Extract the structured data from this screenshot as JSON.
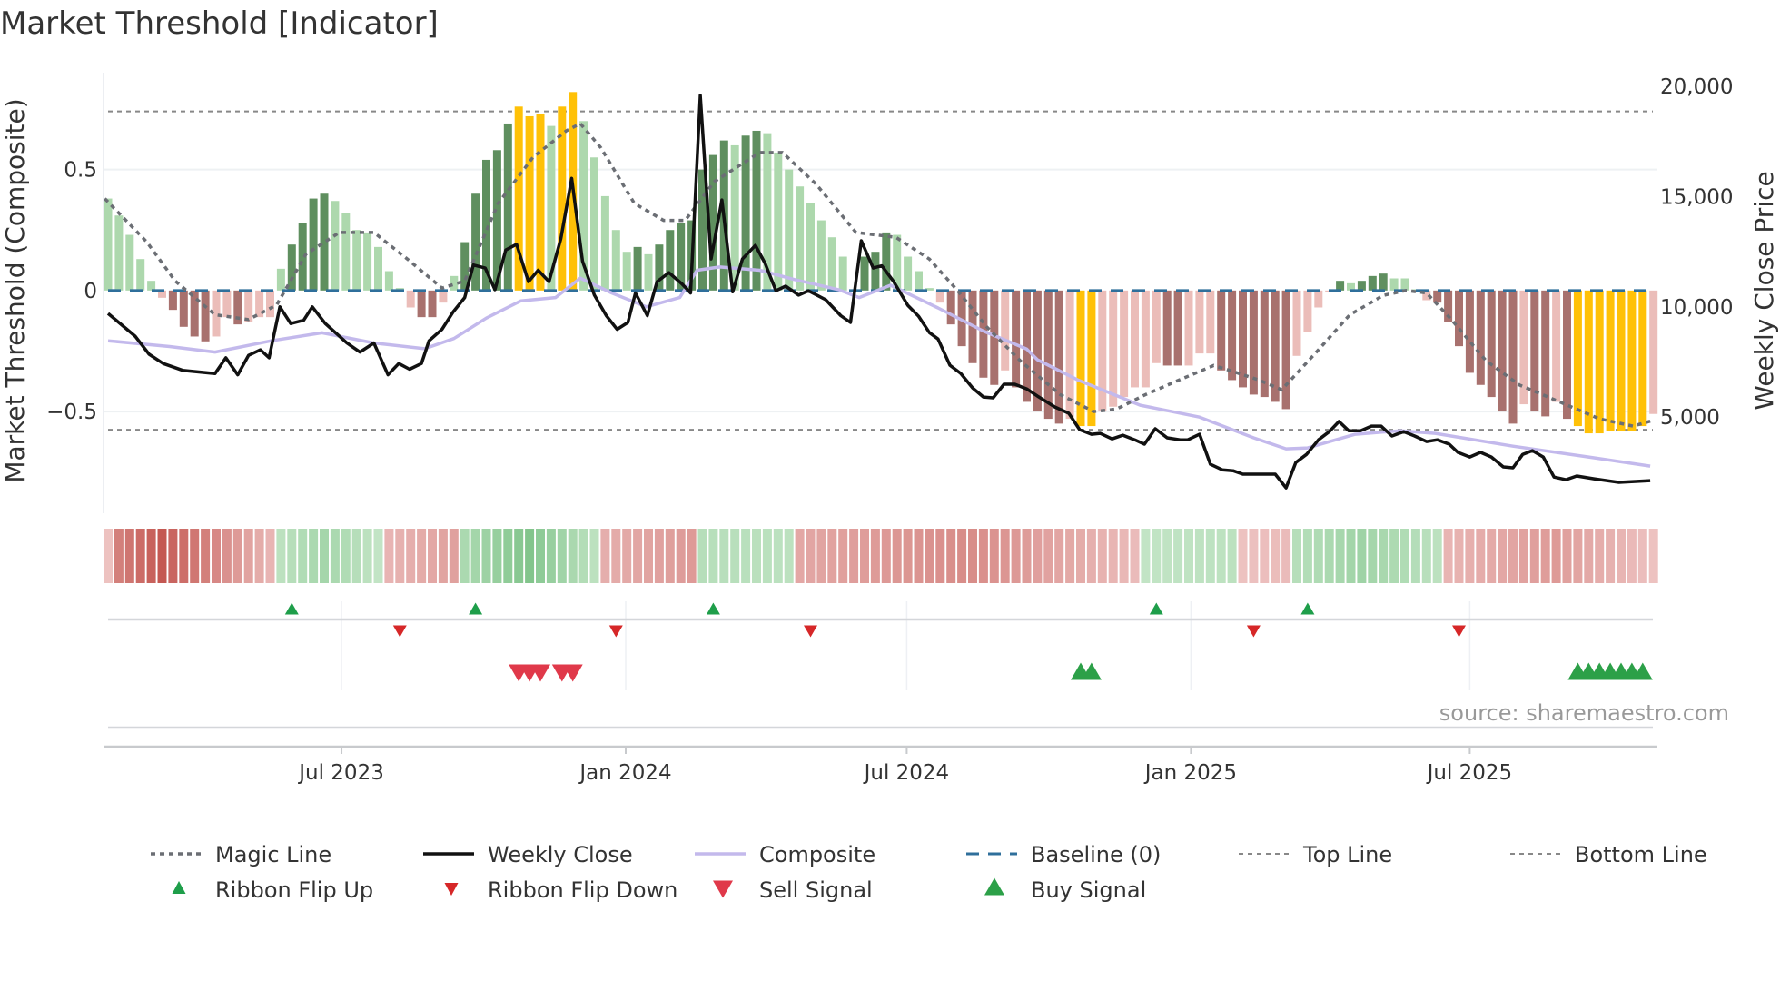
{
  "title": "Market Threshold [Indicator]",
  "source": "source: sharemaestro.com",
  "colors": {
    "dark_green": "#5f8f5f",
    "light_green": "#add8ad",
    "dark_red": "#a8716e",
    "light_pink": "#ebbdb9",
    "yellow": "#ffc107",
    "close": "#111111",
    "composite": "#c3b9ec",
    "magic": "#6b6e74",
    "baseline": "#2f6f9b",
    "threshold": "#888888",
    "flip_up": "#1e9e4a",
    "flip_down": "#d62728",
    "sell": "#e0394a",
    "buy": "#2ca048"
  },
  "chart_data": {
    "type": "bar+line",
    "title": "Market Threshold [Indicator]",
    "ylabel_left": "Market Threshold (Composite)",
    "ylabel_right": "Weekly Close Price",
    "ylim_left": [
      -0.92,
      0.9
    ],
    "ylim_right": [
      640,
      20620
    ],
    "xlim": [
      0.6,
      144.4
    ],
    "left_ticks": [
      {
        "v": 0.5,
        "label": "0.5"
      },
      {
        "v": 0,
        "label": "0"
      },
      {
        "v": -0.5,
        "label": "−0.5"
      }
    ],
    "right_ticks": [
      {
        "v": 20000,
        "label": "20,000"
      },
      {
        "v": 15000,
        "label": "15,000"
      },
      {
        "v": 10000,
        "label": "10,000"
      },
      {
        "v": 5000,
        "label": "5,000"
      }
    ],
    "x_ticks": [
      {
        "week": 22.6,
        "label": "Jul 2023"
      },
      {
        "week": 48.9,
        "label": "Jan 2024"
      },
      {
        "week": 74.9,
        "label": "Jul 2024"
      },
      {
        "week": 101.2,
        "label": "Jan 2025"
      },
      {
        "week": 127,
        "label": "Jul 2025"
      }
    ],
    "top_line": 0.74,
    "bottom_line": -0.575,
    "baseline": 0,
    "bar_values": [
      0.38,
      0.31,
      0.23,
      0.13,
      0.04,
      -0.03,
      -0.08,
      -0.15,
      -0.19,
      -0.21,
      -0.19,
      -0.11,
      -0.14,
      -0.13,
      -0.11,
      -0.11,
      0.09,
      0.19,
      0.28,
      0.38,
      0.4,
      0.37,
      0.32,
      0.25,
      0.24,
      0.18,
      0.08,
      0.01,
      -0.07,
      -0.11,
      -0.11,
      -0.05,
      0.06,
      0.2,
      0.4,
      0.54,
      0.58,
      0.69,
      0.76,
      0.72,
      0.73,
      0.68,
      0.76,
      0.82,
      0.7,
      0.55,
      0.39,
      0.25,
      0.16,
      0.18,
      0.15,
      0.19,
      0.25,
      0.28,
      0.29,
      0.5,
      0.56,
      0.62,
      0.6,
      0.64,
      0.66,
      0.65,
      0.57,
      0.5,
      0.43,
      0.36,
      0.29,
      0.22,
      0.14,
      0.005,
      0.14,
      0.16,
      0.24,
      0.23,
      0.14,
      0.08,
      0.01,
      -0.05,
      -0.14,
      -0.23,
      -0.3,
      -0.36,
      -0.39,
      -0.33,
      -0.4,
      -0.46,
      -0.5,
      -0.53,
      -0.55,
      -0.53,
      -0.56,
      -0.56,
      -0.5,
      -0.48,
      -0.44,
      -0.4,
      -0.4,
      -0.3,
      -0.31,
      -0.31,
      -0.31,
      -0.26,
      -0.26,
      -0.33,
      -0.37,
      -0.4,
      -0.43,
      -0.44,
      -0.46,
      -0.49,
      -0.27,
      -0.17,
      -0.07,
      -0.005,
      0.04,
      0.03,
      0.04,
      0.06,
      0.07,
      0.05,
      0.05,
      0.005,
      -0.04,
      -0.05,
      -0.13,
      -0.23,
      -0.34,
      -0.39,
      -0.44,
      -0.5,
      -0.55,
      -0.47,
      -0.5,
      -0.52,
      -0.46,
      -0.53,
      -0.56,
      -0.59,
      -0.59,
      -0.58,
      -0.58,
      -0.58,
      -0.56,
      -0.51
    ],
    "bar_kinds": [
      "lg",
      "lg",
      "lg",
      "lg",
      "lg",
      "lp",
      "dr",
      "dr",
      "dr",
      "dr",
      "lp",
      "lp",
      "dr",
      "lp",
      "lp",
      "lp",
      "lg",
      "dg",
      "dg",
      "dg",
      "dg",
      "lg",
      "lg",
      "lg",
      "lg",
      "lg",
      "lg",
      "lg",
      "lp",
      "dr",
      "dr",
      "lp",
      "lg",
      "dg",
      "dg",
      "dg",
      "dg",
      "dg",
      "y",
      "y",
      "y",
      "lg",
      "y",
      "y",
      "lg",
      "lg",
      "lg",
      "lg",
      "lg",
      "dg",
      "lg",
      "dg",
      "dg",
      "dg",
      "dg",
      "dg",
      "dg",
      "dg",
      "lg",
      "dg",
      "dg",
      "lg",
      "lg",
      "lg",
      "lg",
      "lg",
      "lg",
      "lg",
      "lg",
      "lg",
      "dg",
      "dg",
      "dg",
      "lg",
      "lg",
      "lg",
      "lg",
      "lp",
      "dr",
      "dr",
      "dr",
      "dr",
      "dr",
      "lp",
      "dr",
      "dr",
      "dr",
      "dr",
      "dr",
      "lp",
      "y",
      "y",
      "lp",
      "lp",
      "lp",
      "lp",
      "lp",
      "lp",
      "dr",
      "dr",
      "lp",
      "lp",
      "lp",
      "dr",
      "dr",
      "dr",
      "dr",
      "dr",
      "dr",
      "dr",
      "lp",
      "lp",
      "lp",
      "lp",
      "dg",
      "lg",
      "dg",
      "dg",
      "dg",
      "lg",
      "lg",
      "lg",
      "lp",
      "dr",
      "dr",
      "dr",
      "dr",
      "dr",
      "dr",
      "dr",
      "dr",
      "lp",
      "dr",
      "dr",
      "lp",
      "dr",
      "y",
      "y",
      "y",
      "y",
      "y",
      "y",
      "y",
      "lp"
    ],
    "weekly_close": [
      [
        1,
        9700
      ],
      [
        3.5,
        8670
      ],
      [
        4.8,
        7850
      ],
      [
        6.1,
        7430
      ],
      [
        7.9,
        7120
      ],
      [
        10.9,
        6970
      ],
      [
        11.9,
        7690
      ],
      [
        13,
        6920
      ],
      [
        14,
        7800
      ],
      [
        15.1,
        8050
      ],
      [
        15.9,
        7690
      ],
      [
        16.9,
        10000
      ],
      [
        17.9,
        9240
      ],
      [
        19.1,
        9390
      ],
      [
        19.9,
        10000
      ],
      [
        21.1,
        9240
      ],
      [
        23.1,
        8360
      ],
      [
        24.3,
        7950
      ],
      [
        25.6,
        8360
      ],
      [
        26.9,
        6920
      ],
      [
        27.9,
        7430
      ],
      [
        28.9,
        7170
      ],
      [
        30,
        7430
      ],
      [
        30.7,
        8460
      ],
      [
        31.9,
        8980
      ],
      [
        32.9,
        9750
      ],
      [
        34,
        10420
      ],
      [
        34.8,
        11900
      ],
      [
        35.9,
        11760
      ],
      [
        36.8,
        10780
      ],
      [
        37.8,
        12580
      ],
      [
        38.8,
        12840
      ],
      [
        39.9,
        11140
      ],
      [
        40.8,
        11660
      ],
      [
        41.8,
        11140
      ],
      [
        42.9,
        13100
      ],
      [
        43.9,
        15830
      ],
      [
        44.9,
        12070
      ],
      [
        46,
        10530
      ],
      [
        47.1,
        9600
      ],
      [
        48.1,
        8980
      ],
      [
        49.1,
        9290
      ],
      [
        49.8,
        10630
      ],
      [
        50.9,
        9600
      ],
      [
        51.8,
        11140
      ],
      [
        52.9,
        11550
      ],
      [
        54.1,
        11040
      ],
      [
        54.9,
        10630
      ],
      [
        55.8,
        19590
      ],
      [
        56.8,
        12170
      ],
      [
        57.8,
        14850
      ],
      [
        58.8,
        10680
      ],
      [
        59.7,
        12170
      ],
      [
        60.9,
        12790
      ],
      [
        61.8,
        11970
      ],
      [
        62.8,
        10730
      ],
      [
        63.7,
        10940
      ],
      [
        64.9,
        10530
      ],
      [
        65.8,
        10730
      ],
      [
        67.4,
        10320
      ],
      [
        68.8,
        9600
      ],
      [
        69.7,
        9290
      ],
      [
        70.7,
        13000
      ],
      [
        71.8,
        11760
      ],
      [
        72.6,
        11860
      ],
      [
        73.7,
        11140
      ],
      [
        75,
        10070
      ],
      [
        76,
        9570
      ],
      [
        77,
        8830
      ],
      [
        77.8,
        8540
      ],
      [
        78.9,
        7350
      ],
      [
        79.9,
        6980
      ],
      [
        81,
        6320
      ],
      [
        82,
        5910
      ],
      [
        82.9,
        5870
      ],
      [
        83.9,
        6490
      ],
      [
        84.9,
        6490
      ],
      [
        86,
        6280
      ],
      [
        87,
        5950
      ],
      [
        88.6,
        5460
      ],
      [
        89.9,
        5170
      ],
      [
        90.9,
        4430
      ],
      [
        92,
        4220
      ],
      [
        92.8,
        4260
      ],
      [
        93.9,
        4010
      ],
      [
        94.9,
        4180
      ],
      [
        96,
        3970
      ],
      [
        96.9,
        3770
      ],
      [
        97.9,
        4470
      ],
      [
        99,
        4060
      ],
      [
        100.2,
        3970
      ],
      [
        100.9,
        3970
      ],
      [
        102,
        4220
      ],
      [
        103,
        2860
      ],
      [
        104.1,
        2610
      ],
      [
        105.1,
        2570
      ],
      [
        106,
        2410
      ],
      [
        109,
        2410
      ],
      [
        110,
        1790
      ],
      [
        110.9,
        2940
      ],
      [
        111.9,
        3310
      ],
      [
        113,
        3970
      ],
      [
        114,
        4340
      ],
      [
        114.9,
        4800
      ],
      [
        115.8,
        4380
      ],
      [
        116.9,
        4380
      ],
      [
        117.9,
        4590
      ],
      [
        118.8,
        4590
      ],
      [
        119.8,
        4140
      ],
      [
        120.9,
        4340
      ],
      [
        121.9,
        4140
      ],
      [
        123,
        3890
      ],
      [
        124,
        3970
      ],
      [
        125.1,
        3770
      ],
      [
        125.9,
        3400
      ],
      [
        127,
        3190
      ],
      [
        128,
        3400
      ],
      [
        129,
        3190
      ],
      [
        130.1,
        2740
      ],
      [
        131,
        2700
      ],
      [
        131.9,
        3310
      ],
      [
        132.8,
        3480
      ],
      [
        133.8,
        3190
      ],
      [
        134.8,
        2280
      ],
      [
        135.9,
        2160
      ],
      [
        136.9,
        2330
      ],
      [
        138.5,
        2200
      ],
      [
        140.8,
        2040
      ],
      [
        143.7,
        2120
      ]
    ],
    "composite": [
      [
        1,
        8460
      ],
      [
        6.7,
        8200
      ],
      [
        10.9,
        7950
      ],
      [
        16.1,
        8460
      ],
      [
        20.8,
        8820
      ],
      [
        25.6,
        8360
      ],
      [
        30.3,
        8100
      ],
      [
        33,
        8560
      ],
      [
        36,
        9490
      ],
      [
        39.2,
        10270
      ],
      [
        42.4,
        10420
      ],
      [
        44.7,
        11300
      ],
      [
        47.6,
        10630
      ],
      [
        50.8,
        10000
      ],
      [
        53.9,
        10420
      ],
      [
        55.5,
        11660
      ],
      [
        57.6,
        11810
      ],
      [
        61.3,
        11660
      ],
      [
        64.5,
        11240
      ],
      [
        68.6,
        10780
      ],
      [
        70.5,
        10420
      ],
      [
        73.4,
        10980
      ],
      [
        77.8,
        9950
      ],
      [
        82,
        8900
      ],
      [
        86,
        8090
      ],
      [
        87,
        7600
      ],
      [
        90.7,
        6690
      ],
      [
        96.5,
        5540
      ],
      [
        102,
        5000
      ],
      [
        107,
        4060
      ],
      [
        110,
        3560
      ],
      [
        112,
        3600
      ],
      [
        116.4,
        4220
      ],
      [
        120.6,
        4380
      ],
      [
        123.8,
        4260
      ],
      [
        131,
        3680
      ],
      [
        138,
        3190
      ],
      [
        143.7,
        2780
      ]
    ],
    "magic_line": [
      [
        0.7,
        0.38
      ],
      [
        4.6,
        0.2
      ],
      [
        7.2,
        0.04
      ],
      [
        10.9,
        -0.1
      ],
      [
        14,
        -0.12
      ],
      [
        16.6,
        -0.06
      ],
      [
        19.3,
        0.15
      ],
      [
        22.4,
        0.24
      ],
      [
        25.6,
        0.24
      ],
      [
        28.7,
        0.13
      ],
      [
        31.9,
        0.01
      ],
      [
        34,
        0.04
      ],
      [
        37.1,
        0.36
      ],
      [
        40.3,
        0.55
      ],
      [
        43.4,
        0.66
      ],
      [
        44.7,
        0.69
      ],
      [
        46.6,
        0.59
      ],
      [
        49.7,
        0.36
      ],
      [
        52.4,
        0.29
      ],
      [
        54.4,
        0.29
      ],
      [
        57.1,
        0.45
      ],
      [
        61.3,
        0.57
      ],
      [
        63.4,
        0.57
      ],
      [
        66.5,
        0.44
      ],
      [
        70.2,
        0.24
      ],
      [
        73.9,
        0.22
      ],
      [
        77,
        0.13
      ],
      [
        79.6,
        0.0
      ],
      [
        82.3,
        -0.15
      ],
      [
        85.4,
        -0.29
      ],
      [
        89.1,
        -0.43
      ],
      [
        92.2,
        -0.5
      ],
      [
        94.3,
        -0.49
      ],
      [
        97,
        -0.43
      ],
      [
        100.1,
        -0.37
      ],
      [
        103.3,
        -0.31
      ],
      [
        104.8,
        -0.33
      ],
      [
        107.5,
        -0.37
      ],
      [
        109.6,
        -0.41
      ],
      [
        112.7,
        -0.26
      ],
      [
        115.9,
        -0.1
      ],
      [
        119,
        -0.02
      ],
      [
        121.1,
        0.0
      ],
      [
        123,
        -0.01
      ],
      [
        125.3,
        -0.12
      ],
      [
        128.5,
        -0.29
      ],
      [
        131.6,
        -0.39
      ],
      [
        135.3,
        -0.46
      ],
      [
        139,
        -0.53
      ],
      [
        142.1,
        -0.56
      ],
      [
        143.7,
        -0.54
      ]
    ],
    "ribbon_segments": [
      [
        1,
        1,
        -0.2,
        -0.2
      ],
      [
        2,
        6,
        -0.7,
        -1.0
      ],
      [
        7,
        16,
        -0.9,
        -0.3
      ],
      [
        17,
        21,
        0.3,
        0.5
      ],
      [
        22,
        26,
        0.45,
        0.25
      ],
      [
        27,
        33,
        -0.3,
        -0.45
      ],
      [
        34,
        40,
        0.45,
        0.8
      ],
      [
        41,
        46,
        0.7,
        0.3
      ],
      [
        47,
        55,
        -0.35,
        -0.5
      ],
      [
        56,
        64,
        0.35,
        0.3
      ],
      [
        65,
        80,
        -0.4,
        -0.6
      ],
      [
        81,
        96,
        -0.6,
        -0.25
      ],
      [
        97,
        105,
        0.25,
        0.3
      ],
      [
        106,
        110,
        -0.2,
        -0.25
      ],
      [
        111,
        117,
        0.35,
        0.55
      ],
      [
        118,
        124,
        0.5,
        0.3
      ],
      [
        125,
        135,
        -0.3,
        -0.5
      ],
      [
        136,
        144,
        -0.45,
        -0.2
      ]
    ],
    "ribbon_flip_up": [
      18,
      35,
      57,
      98,
      112
    ],
    "ribbon_flip_down": [
      28,
      48,
      66,
      107,
      126
    ],
    "sell_signals": [
      39,
      40,
      41,
      43,
      44
    ],
    "buy_signals": [
      91,
      92,
      137,
      138,
      139,
      140,
      141,
      142,
      143
    ],
    "legend": [
      {
        "key": "magic",
        "label": "Magic Line"
      },
      {
        "key": "close",
        "label": "Weekly Close"
      },
      {
        "key": "composite",
        "label": "Composite"
      },
      {
        "key": "baseline",
        "label": "Baseline (0)"
      },
      {
        "key": "top",
        "label": "Top Line"
      },
      {
        "key": "bottom",
        "label": "Bottom Line"
      },
      {
        "key": "flip_up",
        "label": "Ribbon Flip Up"
      },
      {
        "key": "flip_down",
        "label": "Ribbon Flip Down"
      },
      {
        "key": "sell",
        "label": "Sell Signal"
      },
      {
        "key": "buy",
        "label": "Buy Signal"
      }
    ],
    "legend_placement": "bottom"
  }
}
